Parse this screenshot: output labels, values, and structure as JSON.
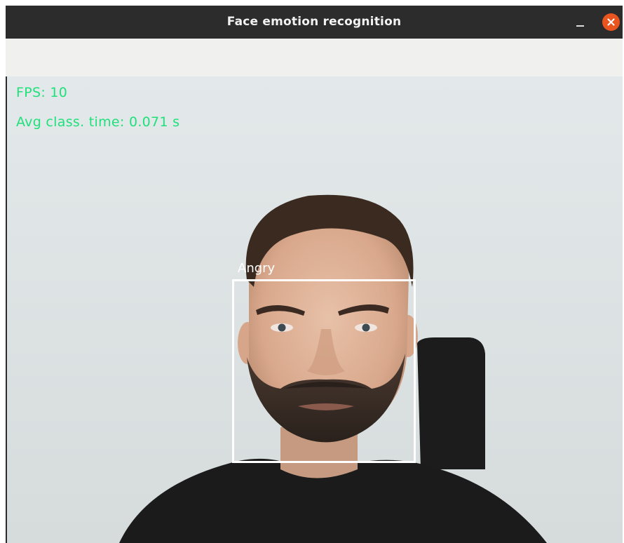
{
  "window": {
    "title": "Face emotion recognition",
    "controls": {
      "minimize_icon": "minimize-icon",
      "close_icon": "close-icon"
    }
  },
  "overlay": {
    "fps_text": "FPS: 10",
    "avg_time_text": "Avg class. time: 0.071 s",
    "text_color": "#1fe07a"
  },
  "detection": {
    "emotion_label": "Angry",
    "box_color": "#ffffff"
  },
  "colors": {
    "titlebar": "#2c2c2c",
    "close_button": "#e9541f",
    "toolbar": "#f0f0ef"
  }
}
